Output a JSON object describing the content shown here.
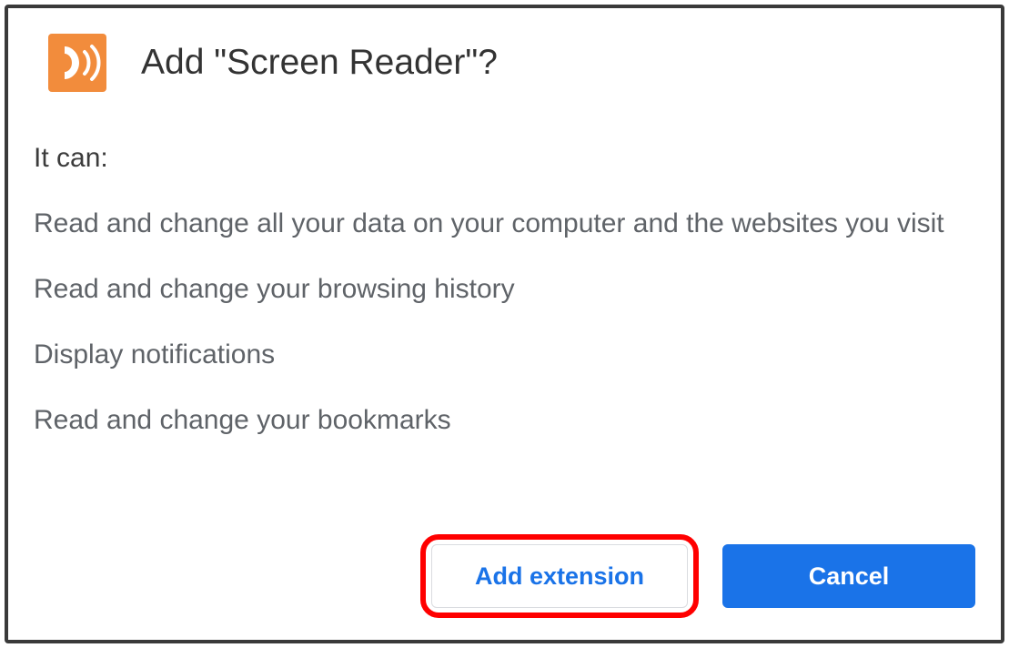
{
  "dialog": {
    "title": "Add \"Screen Reader\"?",
    "subhead": "It can:",
    "permissions": [
      "Read and change all your data on your computer and the websites you visit",
      "Read and change your browsing history",
      "Display notifications",
      "Read and change your bookmarks"
    ],
    "buttons": {
      "add": "Add extension",
      "cancel": "Cancel"
    },
    "colors": {
      "accent": "#1a73e8",
      "highlight": "#ff0000",
      "icon_bg": "#f28c3c"
    }
  }
}
